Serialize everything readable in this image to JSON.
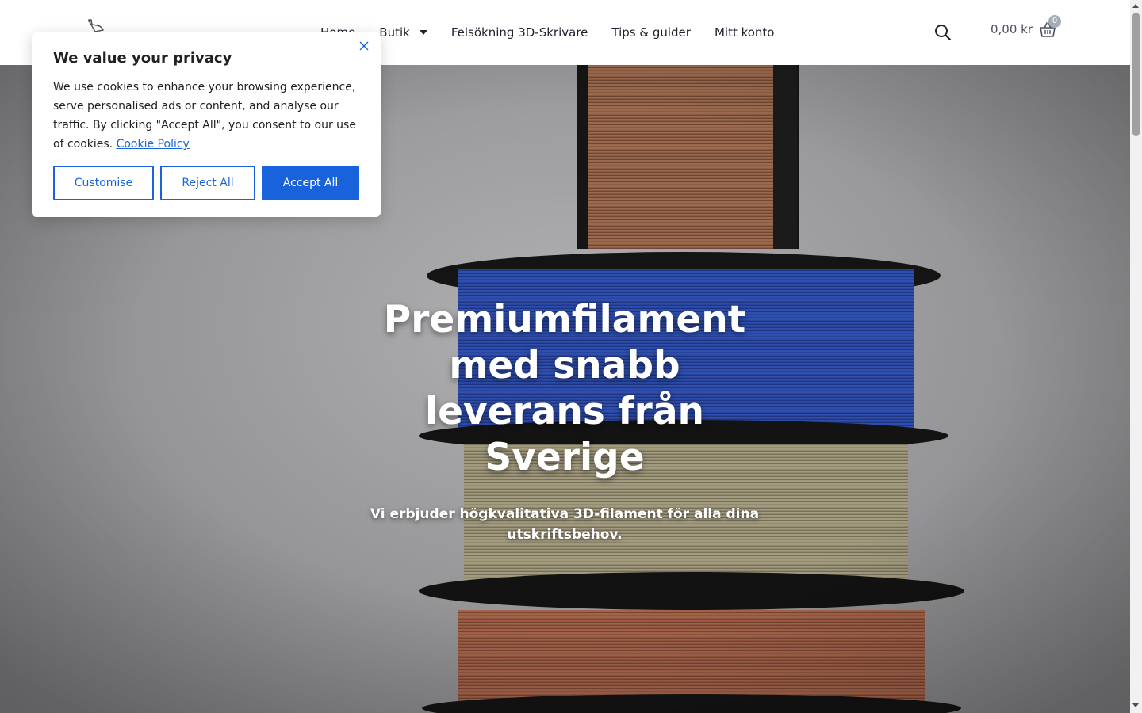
{
  "header": {
    "nav": [
      {
        "label": "Home"
      },
      {
        "label": "Butik"
      },
      {
        "label": "Felsökning 3D-Skrivare"
      },
      {
        "label": "Tips & guider"
      },
      {
        "label": "Mitt konto"
      }
    ],
    "cart_total": "0,00 kr",
    "cart_count": "0"
  },
  "hero": {
    "title": "Premiumfilament med snabb leverans från Sverige",
    "subtitle": "Vi erbjuder högkvalitativa 3D-filament för alla dina utskriftsbehov."
  },
  "cookie": {
    "title": "We value your privacy",
    "text": "We use cookies to enhance your browsing experience, serve personalised ads or content, and analyse our traffic. By clicking \"Accept All\", you consent to our use of cookies.",
    "link": "Cookie Policy",
    "customise": "Customise",
    "reject": "Reject All",
    "accept": "Accept All"
  },
  "colors": {
    "accent": "#1863dc",
    "spool_copper": "#9b6a4e",
    "spool_blue": "#2f4fae",
    "spool_khaki": "#a39b7e",
    "spool_rust": "#a5644a"
  }
}
